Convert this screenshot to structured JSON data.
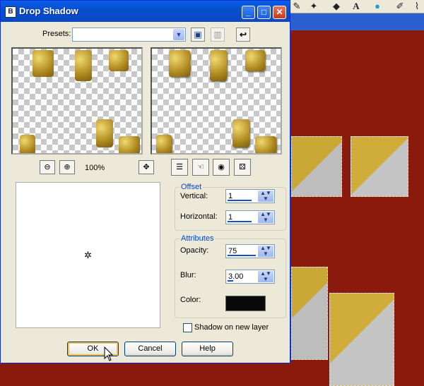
{
  "dialog": {
    "title": "Drop Shadow",
    "presets_label": "Presets:",
    "presets_value": "",
    "zoom_level": "100%"
  },
  "offset": {
    "group_label": "Offset",
    "vertical_label": "Vertical:",
    "vertical_value": "1",
    "horizontal_label": "Horizontal:",
    "horizontal_value": "1"
  },
  "attributes": {
    "group_label": "Attributes",
    "opacity_label": "Opacity:",
    "opacity_value": "75",
    "blur_label": "Blur:",
    "blur_value": "3.00",
    "color_label": "Color:",
    "color_value": "#0a0a0a"
  },
  "options": {
    "shadow_new_layer_label": "Shadow on new layer",
    "shadow_new_layer_checked": false
  },
  "buttons": {
    "ok": "OK",
    "cancel": "Cancel",
    "help": "Help"
  },
  "colors": {
    "titlebar": "#0a5ee8",
    "background_canvas": "#8a1a0c",
    "group_label": "#0046d5"
  }
}
